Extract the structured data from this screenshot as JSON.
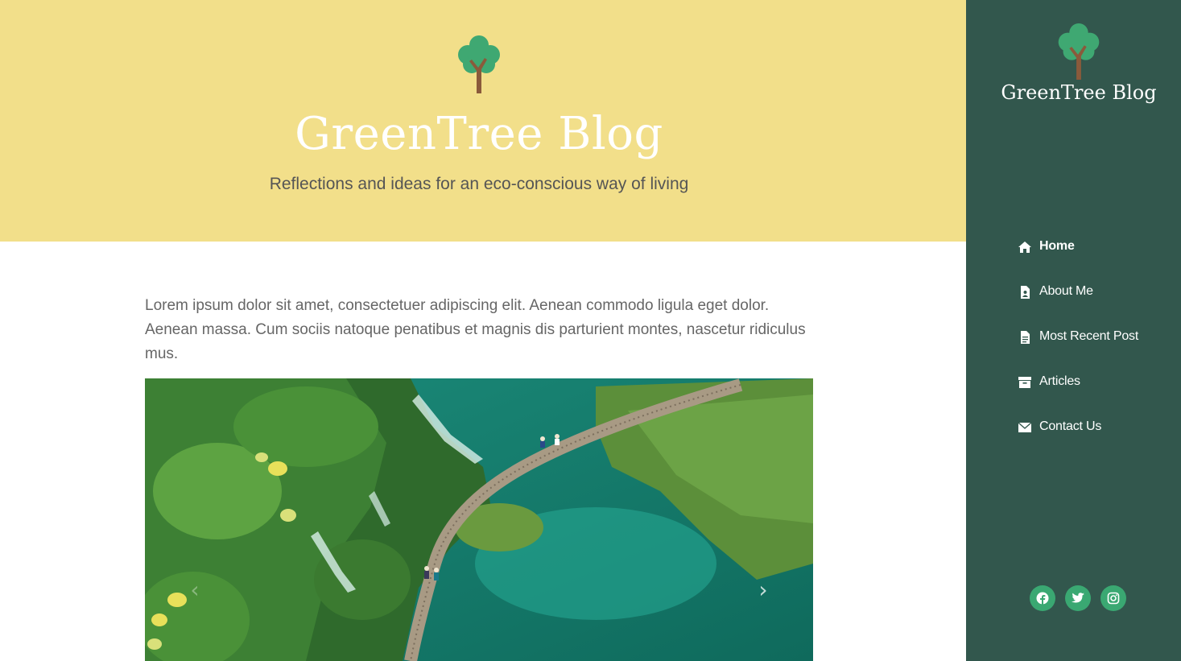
{
  "hero": {
    "title": "GreenTree Blog",
    "subtitle": "Reflections and ideas for an eco-conscious way of living",
    "logo_icon": "tree-icon"
  },
  "intro_text": "Lorem ipsum dolor sit amet, consectetuer adipiscing elit. Aenean commodo ligula eget dolor. Aenean massa. Cum sociis natoque penatibus et magnis dis parturient montes, nascetur ridiculus mus.",
  "carousel": {
    "prev_icon": "chevron-left-icon",
    "next_icon": "chevron-right-icon",
    "prev_glyph": "‹",
    "next_glyph": "›"
  },
  "sidebar": {
    "title": "GreenTree Blog",
    "nav": [
      {
        "label": "Home",
        "icon": "home-icon",
        "active": true
      },
      {
        "label": "About Me",
        "icon": "file-user-icon"
      },
      {
        "label": "Most Recent Post",
        "icon": "document-icon"
      },
      {
        "label": "Articles",
        "icon": "archive-icon"
      },
      {
        "label": "Contact Us",
        "icon": "envelope-icon"
      }
    ],
    "social": [
      {
        "icon": "facebook-icon"
      },
      {
        "icon": "twitter-icon"
      },
      {
        "icon": "instagram-icon"
      }
    ]
  },
  "colors": {
    "hero_bg": "#f2df8a",
    "sidebar_bg": "#32574d",
    "accent_green": "#3aa872",
    "tree_trunk": "#8a5a3b"
  }
}
